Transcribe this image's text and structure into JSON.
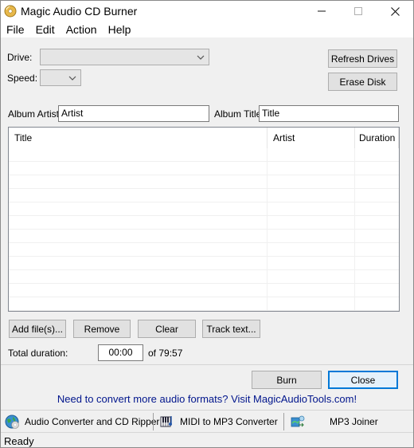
{
  "window": {
    "title": "Magic Audio CD Burner"
  },
  "menu": [
    "File",
    "Edit",
    "Action",
    "Help"
  ],
  "drive": {
    "label": "Drive:",
    "value": ""
  },
  "speed": {
    "label": "Speed:",
    "value": ""
  },
  "buttons": {
    "refresh_drives": "Refresh Drives",
    "erase_disk": "Erase Disk",
    "add_files": "Add file(s)...",
    "remove": "Remove",
    "clear": "Clear",
    "track_text": "Track text...",
    "burn": "Burn",
    "close": "Close"
  },
  "album": {
    "artist_label": "Album Artist:",
    "artist_value": "Artist",
    "title_label": "Album Title:",
    "title_value": "Title"
  },
  "tracklist": {
    "columns": [
      "Title",
      "Artist",
      "Duration"
    ],
    "rows": []
  },
  "duration": {
    "label": "Total duration:",
    "value": "00:00",
    "capacity": "of 79:57"
  },
  "promo": "Need to convert more audio formats? Visit MagicAudioTools.com!",
  "tools": [
    {
      "label": "Audio Converter and CD Ripper",
      "icon": "globe-cd-icon"
    },
    {
      "label": "MIDI to MP3 Converter",
      "icon": "midi-keyboard-icon"
    },
    {
      "label": "MP3  Joiner",
      "icon": "joiner-icon"
    }
  ],
  "status": "Ready",
  "colors": {
    "link": "#00158c",
    "accent": "#0078d7"
  }
}
